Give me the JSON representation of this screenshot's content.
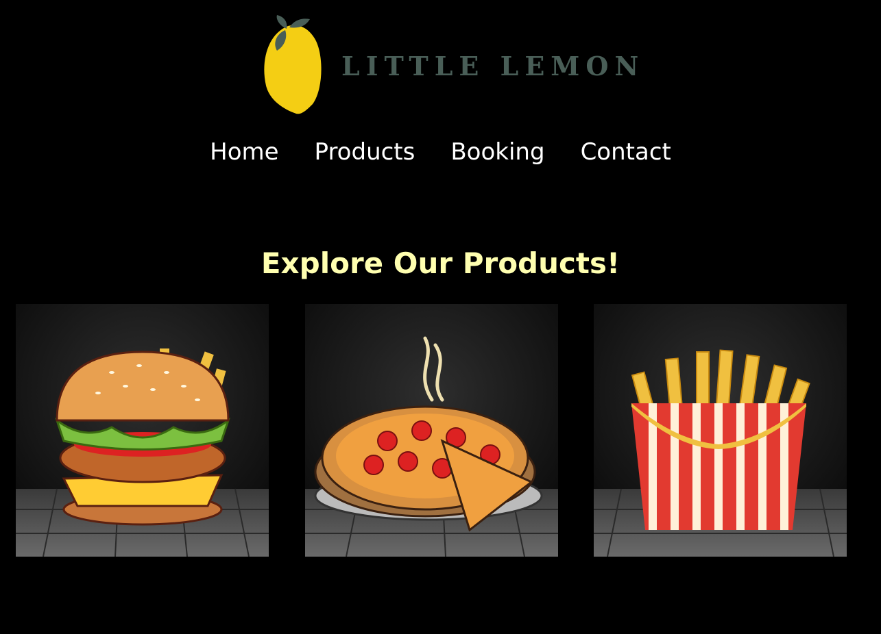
{
  "brand": {
    "name": "LITTLE LEMON",
    "logo_icon": "lemon-icon",
    "colors": {
      "lemon": "#f4ce14",
      "leaf": "#495e57"
    }
  },
  "nav": {
    "items": [
      {
        "label": "Home"
      },
      {
        "label": "Products"
      },
      {
        "label": "Booking"
      },
      {
        "label": "Contact"
      }
    ]
  },
  "main": {
    "heading": "Explore Our Products!",
    "products": [
      {
        "image": "burger-image"
      },
      {
        "image": "pizza-image"
      },
      {
        "image": "fries-image"
      }
    ]
  },
  "colors": {
    "background": "#000000",
    "heading": "#ffffb0",
    "nav_text": "#ffffff"
  }
}
